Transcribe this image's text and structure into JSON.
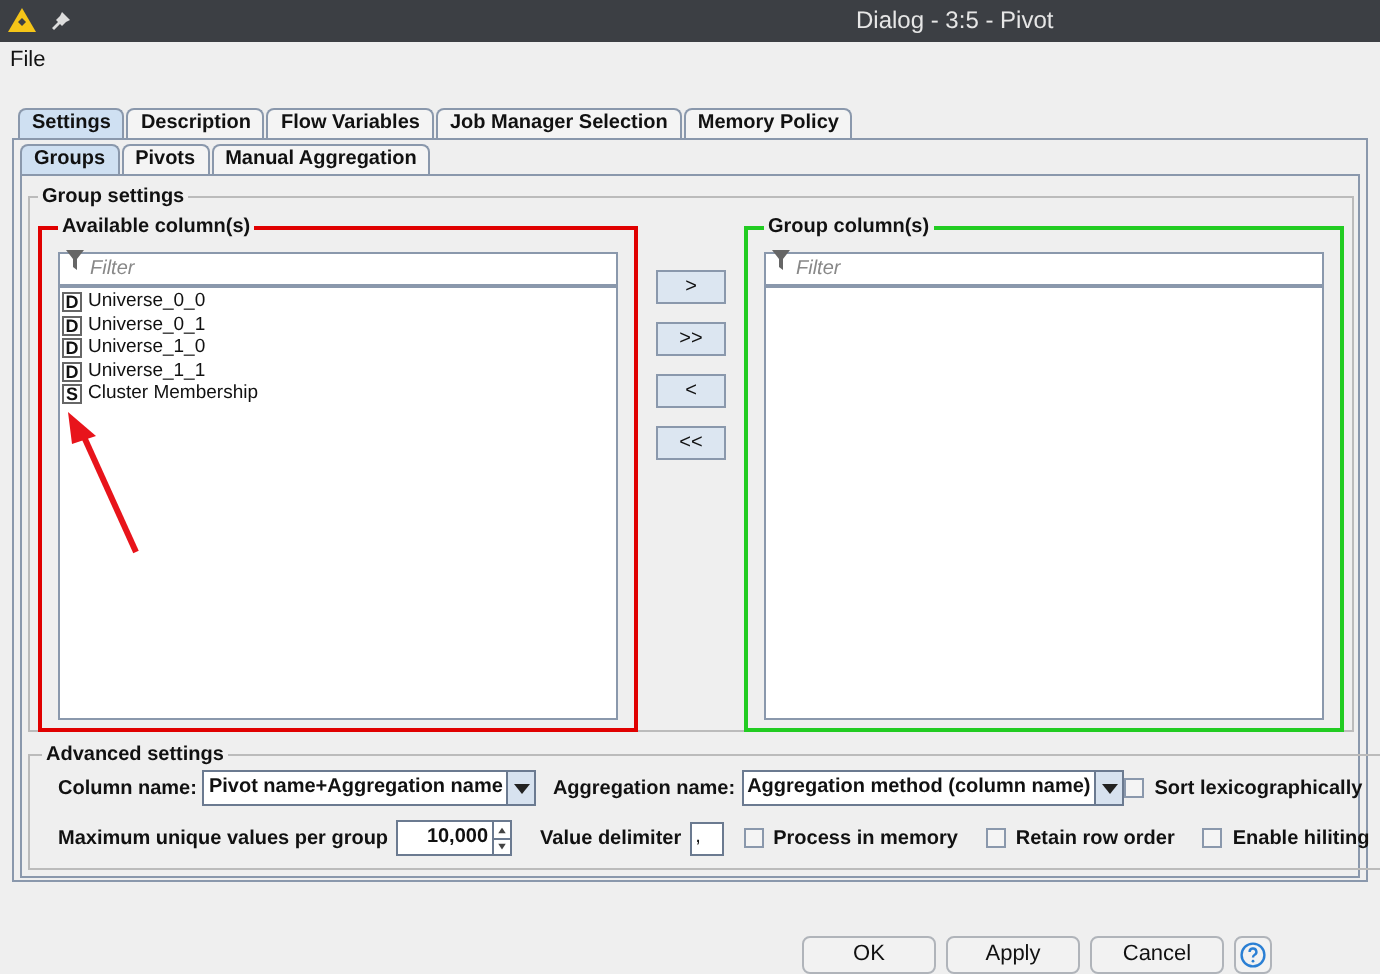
{
  "window": {
    "title": "Dialog - 3:5 - Pivot"
  },
  "menu": [
    "File"
  ],
  "tabs": [
    {
      "label": "Settings",
      "selected": true
    },
    {
      "label": "Description",
      "selected": false
    },
    {
      "label": "Flow Variables",
      "selected": false
    },
    {
      "label": "Job Manager Selection",
      "selected": false
    },
    {
      "label": "Memory Policy",
      "selected": false
    }
  ],
  "subtabs": [
    {
      "label": "Groups",
      "selected": true
    },
    {
      "label": "Pivots",
      "selected": false
    },
    {
      "label": "Manual Aggregation",
      "selected": false
    }
  ],
  "group_settings": {
    "title": "Group settings",
    "available": {
      "title": "Available column(s)",
      "filter_placeholder": "Filter",
      "items": [
        {
          "type": "D",
          "name": "Universe_0_0"
        },
        {
          "type": "D",
          "name": "Universe_0_1"
        },
        {
          "type": "D",
          "name": "Universe_1_0"
        },
        {
          "type": "D",
          "name": "Universe_1_1"
        },
        {
          "type": "S",
          "name": "Cluster Membership"
        }
      ]
    },
    "move_buttons": [
      ">",
      ">>",
      "<",
      "<<"
    ],
    "group": {
      "title": "Group column(s)",
      "filter_placeholder": "Filter"
    }
  },
  "advanced": {
    "title": "Advanced settings",
    "column_name_label": "Column name:",
    "column_name_value": "Pivot name+Aggregation name",
    "aggregation_name_label": "Aggregation name:",
    "aggregation_name_value": "Aggregation method (column name)",
    "max_label": "Maximum unique values per group",
    "max_value": "10,000",
    "delimiter_label": "Value delimiter",
    "delimiter_value": ",",
    "checkboxes": [
      {
        "label": "Sort lexicographically",
        "checked": false
      },
      {
        "label": "Process in memory",
        "checked": false
      },
      {
        "label": "Retain row order",
        "checked": false
      },
      {
        "label": "Enable hiliting",
        "checked": false
      }
    ]
  },
  "buttons": [
    "OK",
    "Apply",
    "Cancel"
  ]
}
